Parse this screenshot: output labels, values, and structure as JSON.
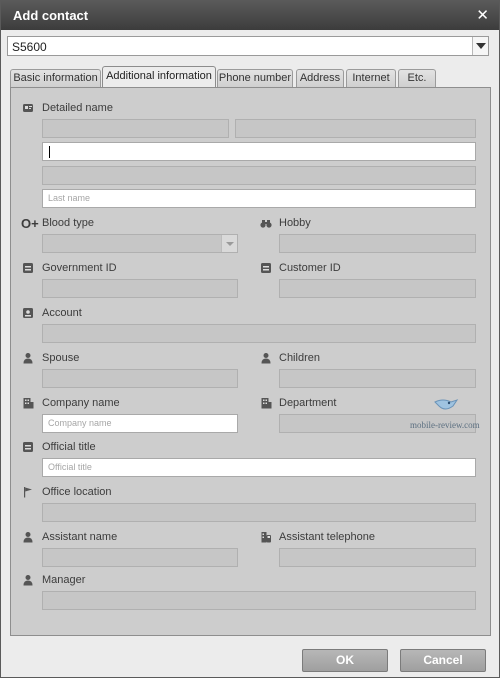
{
  "window": {
    "title": "Add contact",
    "close_label": "✕"
  },
  "device": {
    "selected": "S5600"
  },
  "tabs": [
    {
      "label": "Basic information"
    },
    {
      "label": "Additional information",
      "active": true
    },
    {
      "label": "Phone number"
    },
    {
      "label": "Address"
    },
    {
      "label": "Internet"
    },
    {
      "label": "Etc."
    }
  ],
  "form": {
    "detailed_name": {
      "label": "Detailed name",
      "last_name_placeholder": "Last name"
    },
    "blood_type": {
      "label": "Blood type",
      "prefix": "O+"
    },
    "hobby": {
      "label": "Hobby"
    },
    "government_id": {
      "label": "Government ID"
    },
    "customer_id": {
      "label": "Customer ID"
    },
    "account": {
      "label": "Account"
    },
    "spouse": {
      "label": "Spouse"
    },
    "children": {
      "label": "Children"
    },
    "company_name": {
      "label": "Company name",
      "placeholder": "Company name"
    },
    "department": {
      "label": "Department"
    },
    "official_title": {
      "label": "Official title",
      "placeholder": "Official title"
    },
    "office_location": {
      "label": "Office location"
    },
    "assistant_name": {
      "label": "Assistant name"
    },
    "assistant_telephone": {
      "label": "Assistant telephone"
    },
    "manager": {
      "label": "Manager"
    }
  },
  "buttons": {
    "ok": "OK",
    "cancel": "Cancel"
  },
  "watermark": {
    "text": "mobile-review.com"
  },
  "colors": {
    "titlebar": "#4a4a4a",
    "panel": "#cdcdcd",
    "button": "#aaaaaa"
  },
  "icons": {
    "detailed_name": "id-card-icon",
    "blood_type": "blood-type-icon",
    "hobby": "binoculars-icon",
    "government_id": "id-badge-icon",
    "customer_id": "id-badge-icon",
    "account": "account-icon",
    "spouse": "person-icon",
    "children": "person-icon",
    "company_name": "building-icon",
    "department": "building-icon",
    "official_title": "id-badge-icon",
    "office_location": "flag-icon",
    "assistant_name": "person-icon",
    "assistant_telephone": "phone-building-icon",
    "manager": "person-icon"
  }
}
